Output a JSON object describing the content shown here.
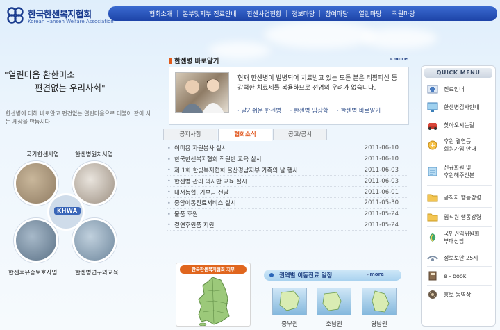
{
  "logo": {
    "name_ko": "한국한센복지협회",
    "name_en": "Korean Hansen Welfare Association"
  },
  "nav": {
    "items": [
      "협회소개",
      "본부및지부 진료안내",
      "한센사업현황",
      "정보마당",
      "참여마당",
      "열린마당",
      "직원마당"
    ]
  },
  "slogan": {
    "line1": "\"열린마음 환한미소",
    "line2": "편견없는 우리사회\"",
    "sub": "한센병에 대해 바로알고 편견없는 열린마음으로 더불어 같이 사는 세상을 만듭시다"
  },
  "clover": {
    "labels": [
      "국가한센사업",
      "한센병원치사업",
      "한센후유증보호사업",
      "한센병연구와교육"
    ],
    "center": "KHWA"
  },
  "intro": {
    "title": "한센병 바로알기",
    "more": "more",
    "text": "현재 한센병이 발병되어 치료받고 있는 모든 분은 리팜피신 등 강력한 치료제를 복용하므로 전염의 우려가 없습니다.",
    "links": [
      "알기쉬운 한센병",
      "한센병 임상학",
      "한센병 바로알기"
    ]
  },
  "tabs": [
    "공지사항",
    "협회소식",
    "공고/공시"
  ],
  "news": [
    {
      "title": "이미용 자원봉사 실시",
      "date": "2011-06-10"
    },
    {
      "title": "한국한센복지협회 직원반 교육 실시",
      "date": "2011-06-10"
    },
    {
      "title": "제 1회 한빛복지협회 울산경남지부 가족의 날 행사",
      "date": "2011-06-03"
    },
    {
      "title": "한센병 관리 의사반 교육 실시",
      "date": "2011-06-03"
    },
    {
      "title": "내서농협, 기부금 전달",
      "date": "2011-06-01"
    },
    {
      "title": "중앙이동진료서비스 실시",
      "date": "2011-05-30"
    },
    {
      "title": "물품 후원",
      "date": "2011-05-24"
    },
    {
      "title": "결연후원품 지원",
      "date": "2011-05-24"
    }
  ],
  "map_widget": {
    "header": "한국한센복지협회 지부"
  },
  "mobile_clinic": {
    "title": "권역별 이동진료 일정",
    "more": "more",
    "regions": [
      "중부권",
      "호남권",
      "영남권"
    ]
  },
  "quick_menu": {
    "title": "QUICK MENU",
    "items": [
      {
        "label": "진료안내",
        "icon": "clinic-icon"
      },
      {
        "label": "한센병검사안내",
        "icon": "monitor-icon"
      },
      {
        "label": "찾아오시는길",
        "icon": "car-icon"
      },
      {
        "label": "후원 결연등\n회원가입 안내",
        "icon": "donation-icon"
      },
      {
        "label": "신규회원 및\n후원해주신분",
        "icon": "members-icon"
      },
      {
        "label": "공직자 행동강령",
        "icon": "folder-icon"
      },
      {
        "label": "임직원 행동강령",
        "icon": "folder-icon"
      },
      {
        "label": "국민권익위원회\n부패상담",
        "icon": "rights-icon"
      },
      {
        "label": "정보보안 25시",
        "icon": "security-icon"
      },
      {
        "label": "e - book",
        "icon": "ebook-icon"
      },
      {
        "label": "홍보 동영상",
        "icon": "film-icon"
      }
    ]
  },
  "colors": {
    "nav_blue": "#1d44a8",
    "accent_orange": "#e0541a",
    "brand_navy": "#1a3c8f"
  }
}
